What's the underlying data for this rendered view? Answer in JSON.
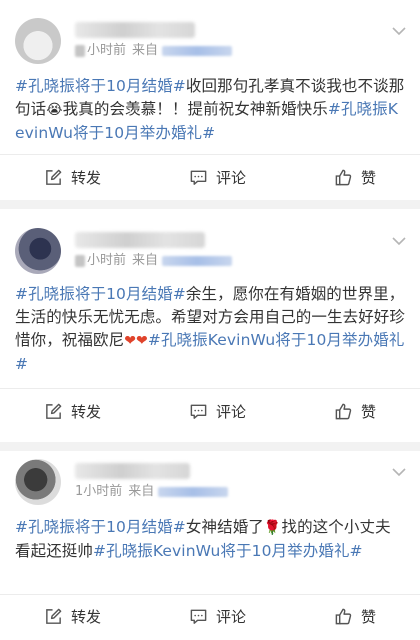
{
  "posts": [
    {
      "time": "小时前",
      "source_label": "来自",
      "text_parts": [
        {
          "t": "#孔晓振将于10月结婚#",
          "topic": true
        },
        {
          "t": "收回那句孔孝真不谈我也不谈那句话",
          "topic": false
        },
        {
          "t": "😭",
          "topic": false
        },
        {
          "t": "我真的会羡慕！！提前祝女神新婚快乐",
          "topic": false
        },
        {
          "t": "#孔晓振KevinWu将于10月举办婚礼#",
          "topic": true
        }
      ],
      "actions": {
        "repost": "转发",
        "comment": "评论",
        "like": "赞"
      }
    },
    {
      "time": "小时前",
      "source_label": "来自",
      "text_parts": [
        {
          "t": "#孔晓振将于10月结婚#",
          "topic": true
        },
        {
          "t": "余生，愿你在有婚姻的世界里，生活的快乐无忧无虑。希望对方会用自己的一生去好好珍惜你，祝福欧尼",
          "topic": false
        },
        {
          "t": "❤❤",
          "topic": false
        },
        {
          "t": "#孔晓振KevinWu将于10月举办婚礼#",
          "topic": true
        }
      ],
      "actions": {
        "repost": "转发",
        "comment": "评论",
        "like": "赞"
      }
    },
    {
      "time": "1小时前",
      "source_label": "来自",
      "text_parts": [
        {
          "t": "#孔晓振将于10月结婚#",
          "topic": true
        },
        {
          "t": "女神结婚了",
          "topic": false
        },
        {
          "t": "🌹",
          "topic": false
        },
        {
          "t": "找的这个小丈夫看起还挺帅",
          "topic": false
        },
        {
          "t": "#孔晓振KevinWu将于10月举办婚礼#",
          "topic": true
        }
      ],
      "actions": {
        "repost": "转发",
        "comment": "评论",
        "like": "赞"
      }
    }
  ],
  "colors": {
    "topic": "#4a78b5",
    "meta": "#999999",
    "background": "#f2f2f2"
  },
  "icons": {
    "repost": "edit-square-icon",
    "comment": "comment-bubble-icon",
    "like": "thumbs-up-icon",
    "menu": "chevron-down-icon"
  }
}
